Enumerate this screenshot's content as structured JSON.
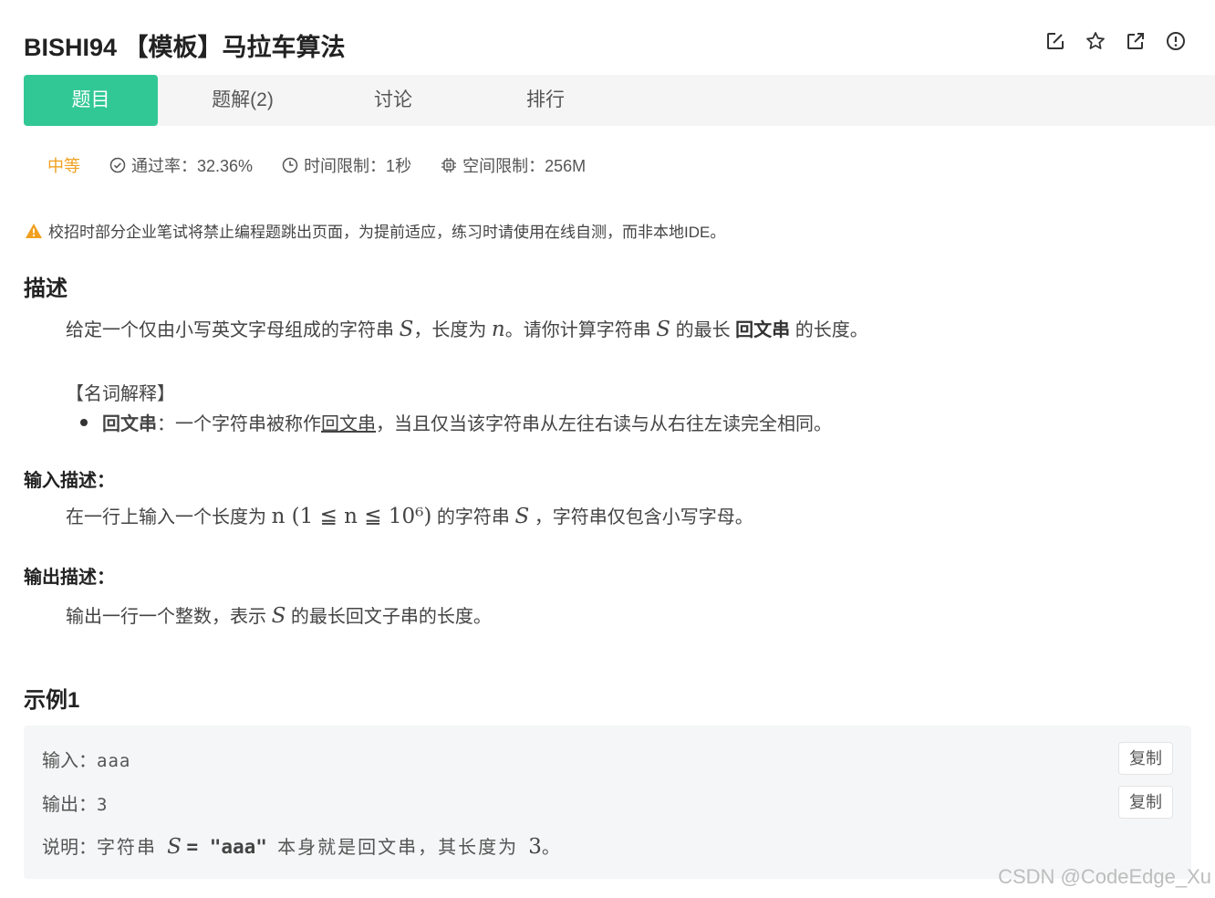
{
  "header": {
    "title": "BISHI94 【模板】马拉车算法",
    "icons": [
      "edit-icon",
      "star-icon",
      "external-link-icon",
      "report-icon"
    ]
  },
  "tabs": [
    {
      "label": "题目",
      "active": true
    },
    {
      "label": "题解(2)",
      "active": false
    },
    {
      "label": "讨论",
      "active": false
    },
    {
      "label": "排行",
      "active": false
    }
  ],
  "meta": {
    "difficulty": "中等",
    "pass_rate": "通过率：32.36%",
    "time_limit": "时间限制：1秒",
    "space_limit": "空间限制：256M"
  },
  "notice": "校招时部分企业笔试将禁止编程题跳出页面，为提前适应，练习时请使用在线自测，而非本地IDE。",
  "description": {
    "heading": "描述",
    "p1_a": "给定一个仅由小写英文字母组成的字符串",
    "var_S": "S",
    "p1_b": "，长度为",
    "var_n": "n",
    "p1_c": "。请你计算字符串",
    "p1_d": "的最长",
    "p1_bold": "回文串",
    "p1_e": "的长度。",
    "glossary_title": "【名词解释】",
    "glossary_term": "回文串",
    "glossary_a": "：一个字符串被称作",
    "glossary_link": "回文串",
    "glossary_b": "，当且仅当该字符串从左往右读与从右往左读完全相同。"
  },
  "input_desc": {
    "heading": "输入描述：",
    "a": "在一行上输入一个长度为",
    "math": "n (1 ≦ n ≦ 10⁶)",
    "b": "的字符串",
    "c": "，字符串仅包含小写字母。"
  },
  "output_desc": {
    "heading": "输出描述：",
    "a": "输出一行一个整数，表示",
    "b": "的最长回文子串的长度。"
  },
  "example": {
    "heading": "示例1",
    "input_label": "输入：",
    "input_value": "aaa",
    "output_label": "输出：",
    "output_value": "3",
    "explain_label": "说明：",
    "explain_a": "字符串",
    "explain_eq": "= \"aaa\"",
    "explain_b": "本身就是回文串，其长度为",
    "explain_num": "3",
    "explain_end": "。",
    "copy_label": "复制"
  },
  "watermark": "CSDN @CodeEdge_Xu",
  "colors": {
    "accent": "#32c896",
    "difficulty": "#f0a020",
    "warning": "#f0a020"
  }
}
